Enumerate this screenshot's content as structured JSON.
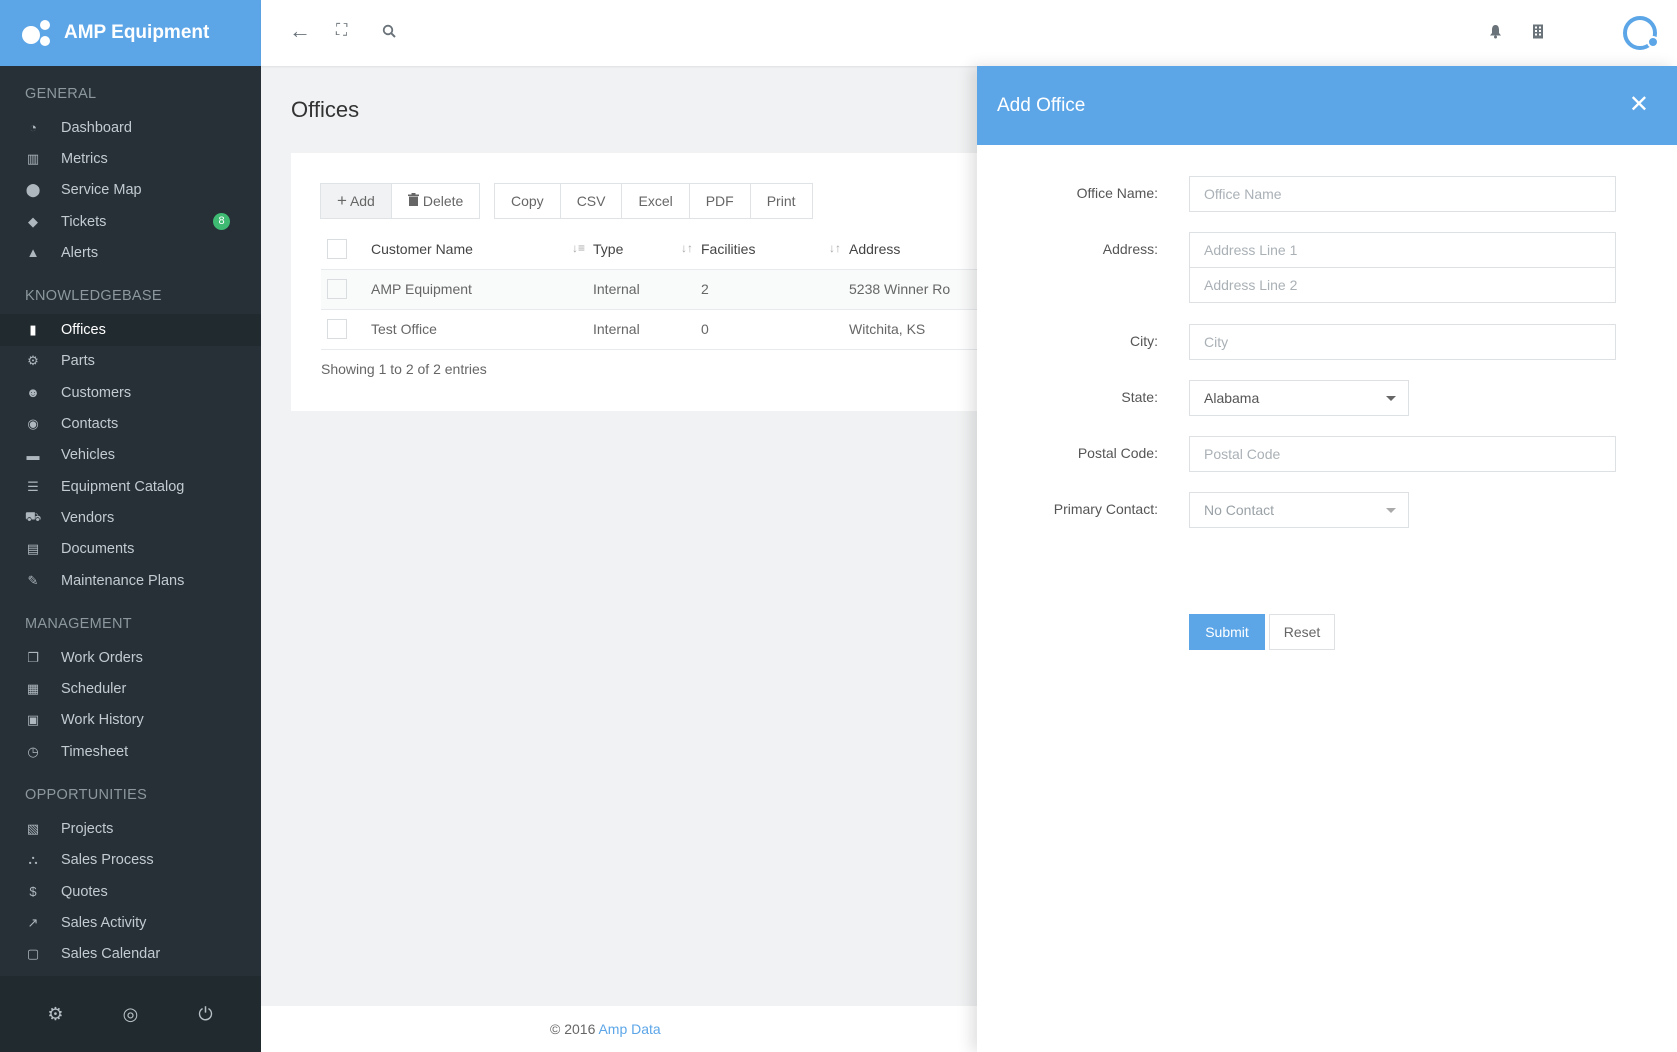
{
  "brand": {
    "name": "AMP Equipment"
  },
  "sidebar": {
    "sections": [
      {
        "title": "GENERAL",
        "items": [
          {
            "label": "Dashboard",
            "icon": "dashboard-icon",
            "glyph": "◔"
          },
          {
            "label": "Metrics",
            "icon": "bar-chart-icon",
            "glyph": "▥"
          },
          {
            "label": "Service Map",
            "icon": "map-marker-icon",
            "glyph": "⬤"
          },
          {
            "label": "Tickets",
            "icon": "ticket-icon",
            "glyph": "◆",
            "badge": "8"
          },
          {
            "label": "Alerts",
            "icon": "warning-icon",
            "glyph": "▲"
          }
        ]
      },
      {
        "title": "KNOWLEDGEBASE",
        "items": [
          {
            "label": "Offices",
            "icon": "building-icon",
            "glyph": "▮",
            "active": true
          },
          {
            "label": "Parts",
            "icon": "cogs-icon",
            "glyph": "⚙"
          },
          {
            "label": "Customers",
            "icon": "users-icon",
            "glyph": "☻"
          },
          {
            "label": "Contacts",
            "icon": "user-circle-icon",
            "glyph": "◉"
          },
          {
            "label": "Vehicles",
            "icon": "truck-icon",
            "glyph": "▬"
          },
          {
            "label": "Equipment Catalog",
            "icon": "list-icon",
            "glyph": "☰"
          },
          {
            "label": "Vendors",
            "icon": "cart-icon",
            "glyph": "⛟"
          },
          {
            "label": "Documents",
            "icon": "file-icon",
            "glyph": "▤"
          },
          {
            "label": "Maintenance Plans",
            "icon": "wrench-icon",
            "glyph": "✎"
          }
        ]
      },
      {
        "title": "MANAGEMENT",
        "items": [
          {
            "label": "Work Orders",
            "icon": "copy-icon",
            "glyph": "❐"
          },
          {
            "label": "Scheduler",
            "icon": "calendar-icon",
            "glyph": "▦"
          },
          {
            "label": "Work History",
            "icon": "calendar-check-icon",
            "glyph": "▣"
          },
          {
            "label": "Timesheet",
            "icon": "clock-icon",
            "glyph": "◷"
          }
        ]
      },
      {
        "title": "OPPORTUNITIES",
        "items": [
          {
            "label": "Projects",
            "icon": "clipboard-icon",
            "glyph": "▧"
          },
          {
            "label": "Sales Process",
            "icon": "sitemap-icon",
            "glyph": "⛬"
          },
          {
            "label": "Quotes",
            "icon": "dollar-icon",
            "glyph": "$"
          },
          {
            "label": "Sales Activity",
            "icon": "line-chart-icon",
            "glyph": "↗"
          },
          {
            "label": "Sales Calendar",
            "icon": "calendar-o-icon",
            "glyph": "▢"
          }
        ]
      }
    ],
    "footer_icons": [
      "gear-icon",
      "eye-slash-icon",
      "power-icon"
    ]
  },
  "topbar": {
    "icons": [
      "back-arrow-icon",
      "fullscreen-icon",
      "search-icon",
      "bell-icon",
      "building-icon",
      "avatar"
    ]
  },
  "main": {
    "title": "Offices",
    "toolbar": {
      "add": "Add",
      "delete": "Delete",
      "export": [
        "Copy",
        "CSV",
        "Excel",
        "PDF",
        "Print"
      ]
    },
    "table": {
      "columns": [
        "Customer Name",
        "Type",
        "Facilities",
        "Address"
      ],
      "rows": [
        [
          "AMP Equipment",
          "Internal",
          "2",
          "5238 Winner Ro"
        ],
        [
          "Test Office",
          "Internal",
          "0",
          "Witchita, KS"
        ]
      ]
    },
    "info": "Showing 1 to 2 of 2 entries"
  },
  "footer": {
    "copyright": "© 2016 ",
    "link": "Amp Data"
  },
  "panel": {
    "title": "Add Office",
    "fields": {
      "office_name_label": "Office Name:",
      "office_name_placeholder": "Office Name",
      "address_label": "Address:",
      "address1_placeholder": "Address Line 1",
      "address2_placeholder": "Address Line 2",
      "city_label": "City:",
      "city_placeholder": "City",
      "state_label": "State:",
      "state_value": "Alabama",
      "postal_label": "Postal Code:",
      "postal_placeholder": "Postal Code",
      "contact_label": "Primary Contact:",
      "contact_value": "No Contact"
    },
    "submit": "Submit",
    "reset": "Reset"
  },
  "colors": {
    "accent": "#5ca6e8",
    "sidebar": "#263036",
    "badge": "#3fba73"
  }
}
